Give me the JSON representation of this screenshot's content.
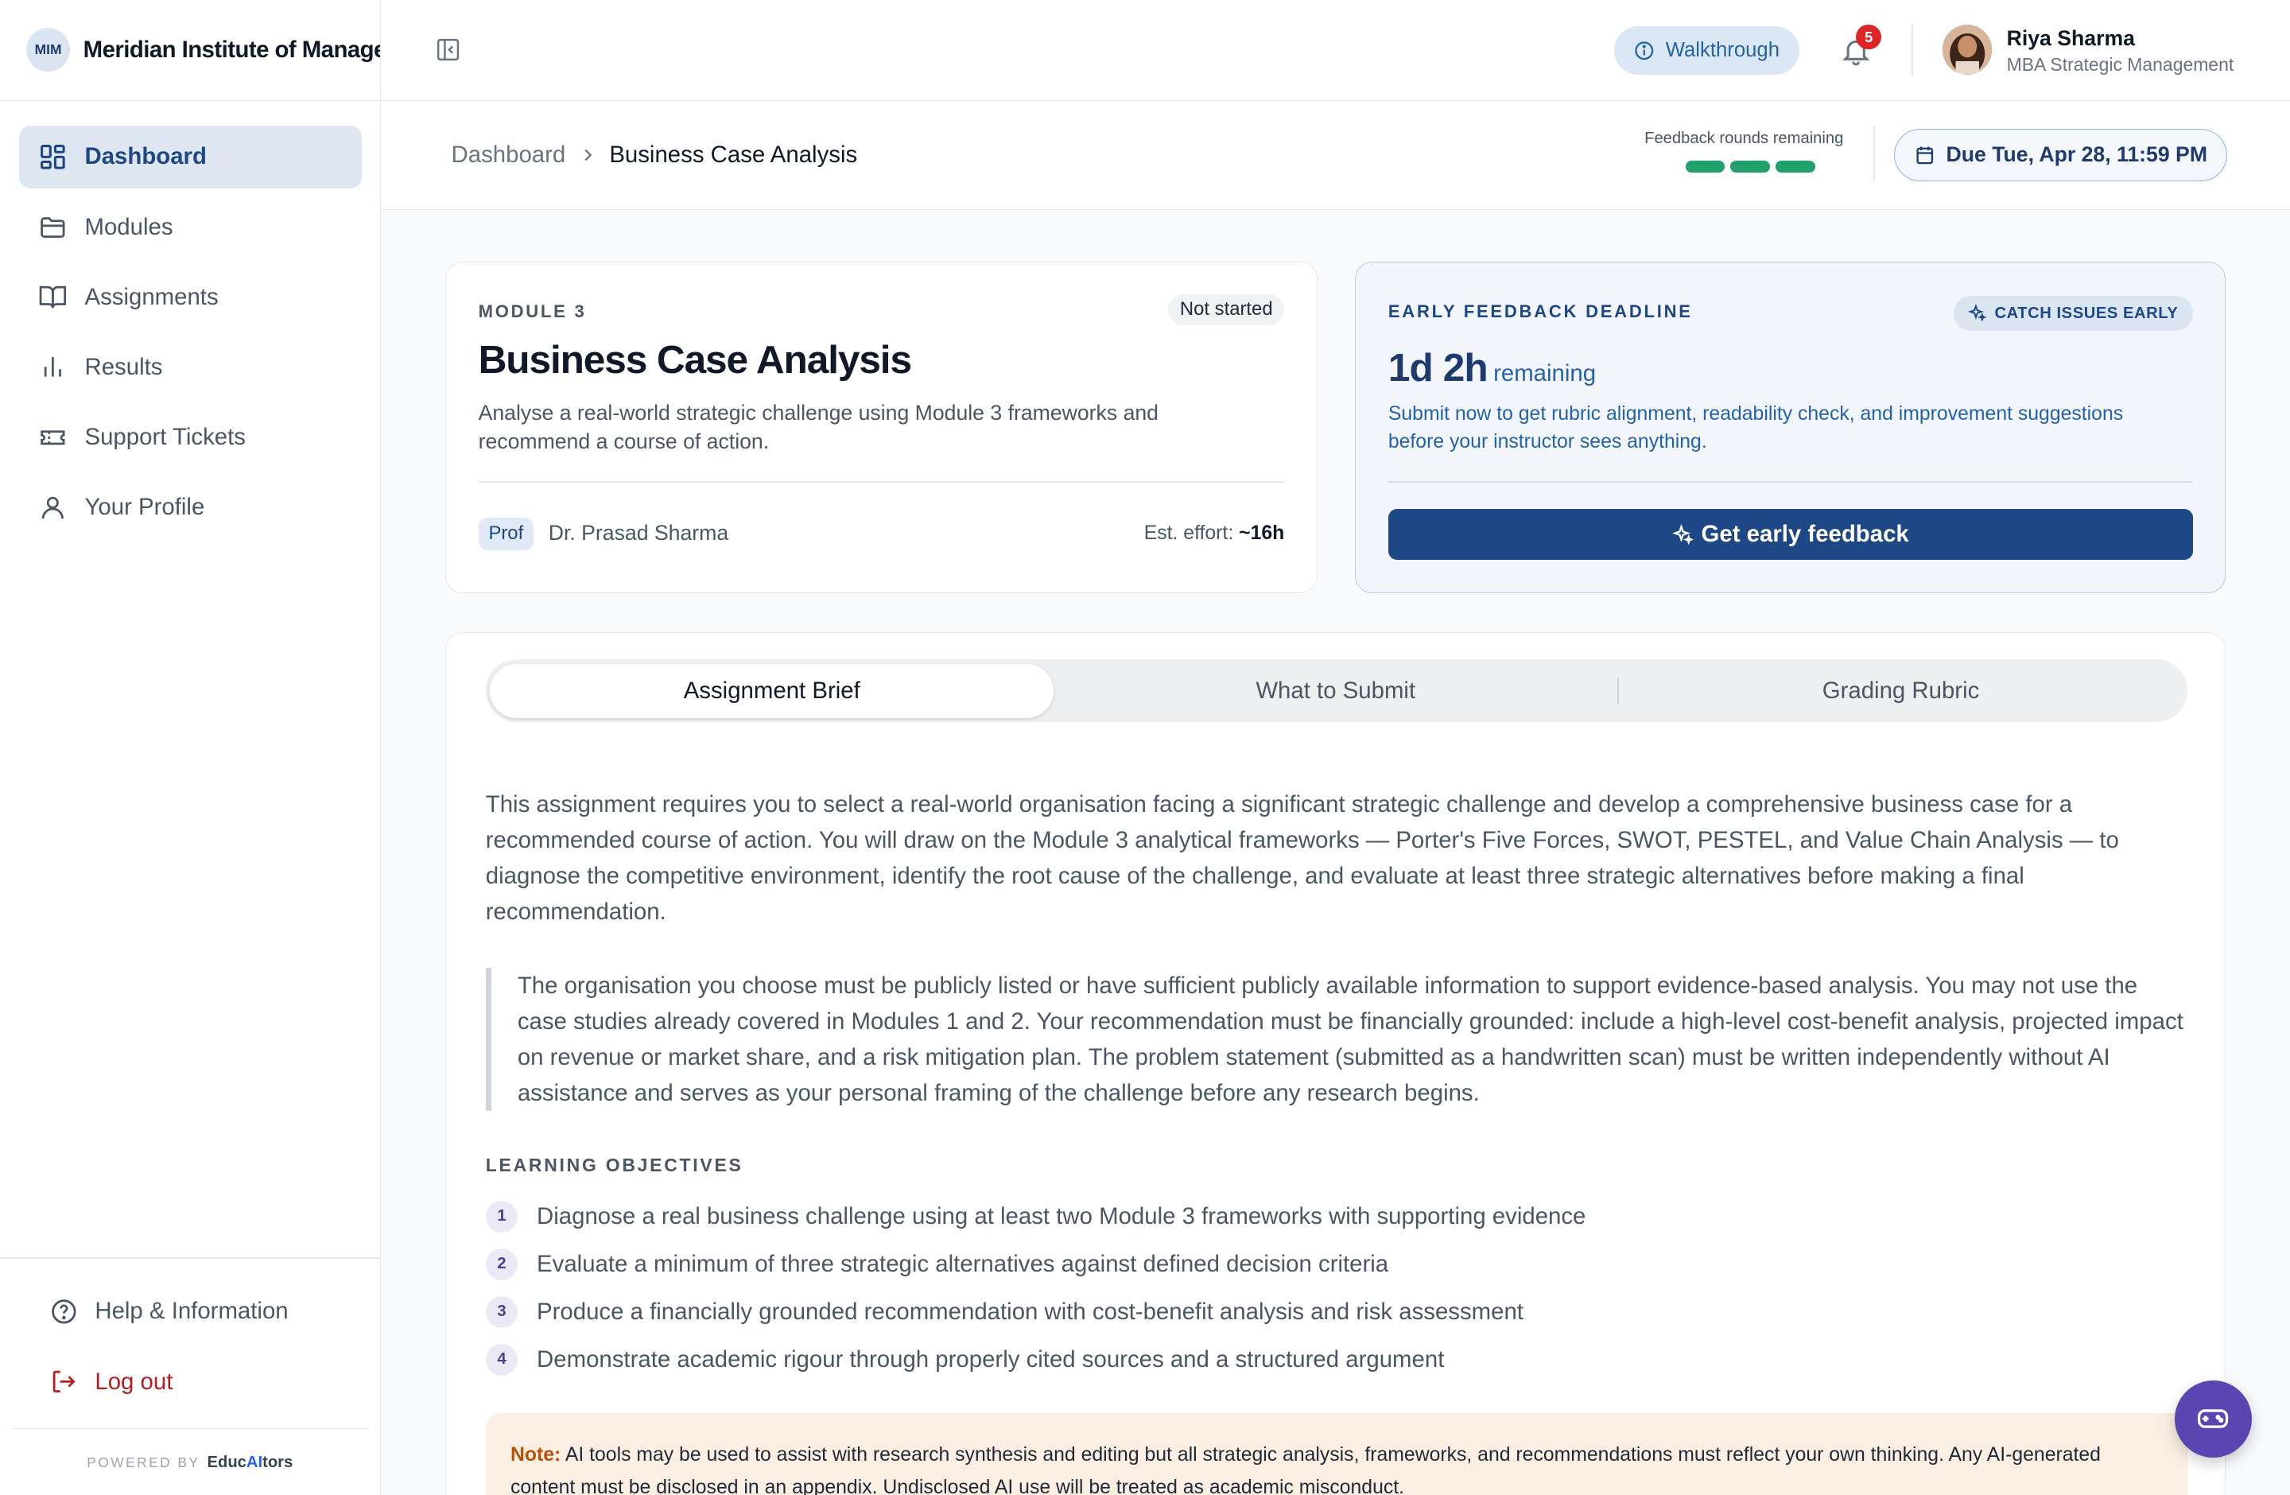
{
  "app": {
    "logo_badge": "MIM",
    "logo_text": "Meridian Institute of Management"
  },
  "sidebar": {
    "items": [
      {
        "label": "Dashboard",
        "icon": "dashboard-grid-icon",
        "active": true
      },
      {
        "label": "Modules",
        "icon": "folder-icon"
      },
      {
        "label": "Assignments",
        "icon": "book-open-icon"
      },
      {
        "label": "Results",
        "icon": "bar-chart-icon"
      },
      {
        "label": "Support Tickets",
        "icon": "ticket-icon"
      },
      {
        "label": "Your Profile",
        "icon": "user-icon"
      }
    ],
    "help_label": "Help & Information",
    "logout_label": "Log out",
    "powered_by": "POWERED BY",
    "powered_brand_a": "Educ",
    "powered_brand_b": "AI",
    "powered_brand_c": "tors"
  },
  "topbar": {
    "walkthrough_label": "Walkthrough",
    "notification_count": "5",
    "user_name": "Riya Sharma",
    "user_program": "MBA Strategic Management"
  },
  "breadcrumb": {
    "parent": "Dashboard",
    "current": "Business Case Analysis"
  },
  "feedback": {
    "label": "Feedback rounds remaining",
    "rounds_remaining": 3
  },
  "due": {
    "label": "Due Tue, Apr 28, 11:59 PM"
  },
  "assignment": {
    "module_label": "MODULE 3",
    "status": "Not started",
    "title": "Business Case Analysis",
    "description": "Analyse a real-world strategic challenge using Module 3 frameworks and recommend a course of action.",
    "prof_tag": "Prof",
    "prof_name": "Dr. Prasad Sharma",
    "effort_label": "Est. effort: ",
    "effort_value": "~16h"
  },
  "early_feedback": {
    "label": "EARLY FEEDBACK DEADLINE",
    "pill": "CATCH ISSUES EARLY",
    "time": "1d 2h",
    "remaining": "remaining",
    "description": "Submit now to get rubric alignment, readability check, and improvement suggestions before your instructor sees anything.",
    "button": "Get early feedback"
  },
  "tabs": [
    {
      "label": "Assignment Brief",
      "active": true
    },
    {
      "label": "What to Submit"
    },
    {
      "label": "Grading Rubric"
    }
  ],
  "brief": {
    "paragraph": "This assignment requires you to select a real-world organisation facing a significant strategic challenge and develop a comprehensive business case for a recommended course of action. You will draw on the Module 3 analytical frameworks — Porter's Five Forces, SWOT, PESTEL, and Value Chain Analysis — to diagnose the competitive environment, identify the root cause of the challenge, and evaluate at least three strategic alternatives before making a final recommendation.",
    "quote": "The organisation you choose must be publicly listed or have sufficient publicly available information to support evidence-based analysis. You may not use the case studies already covered in Modules 1 and 2. Your recommendation must be financially grounded: include a high-level cost-benefit analysis, projected impact on revenue or market share, and a risk mitigation plan. The problem statement (submitted as a handwritten scan) must be written independently without AI assistance and serves as your personal framing of the challenge before any research begins.",
    "objectives_label": "LEARNING OBJECTIVES",
    "objectives": [
      {
        "num": "1",
        "text": "Diagnose a real business challenge using at least two Module 3 frameworks with supporting evidence"
      },
      {
        "num": "2",
        "text": "Evaluate a minimum of three strategic alternatives against defined decision criteria"
      },
      {
        "num": "3",
        "text": "Produce a financially grounded recommendation with cost-benefit analysis and risk assessment"
      },
      {
        "num": "4",
        "text": "Demonstrate academic rigour through properly cited sources and a structured argument"
      }
    ],
    "note_label": "Note:",
    "note_text": " AI tools may be used to assist with research synthesis and editing but all strategic analysis, frameworks, and recommendations must reflect your own thinking. Any AI-generated content must be disclosed in an appendix. Undisclosed AI use will be treated as academic misconduct."
  },
  "colors": {
    "accent": "#1e4785",
    "feedback_green": "#22a06b",
    "fab_purple": "#5b45b0",
    "notification_red": "#dc2626"
  }
}
